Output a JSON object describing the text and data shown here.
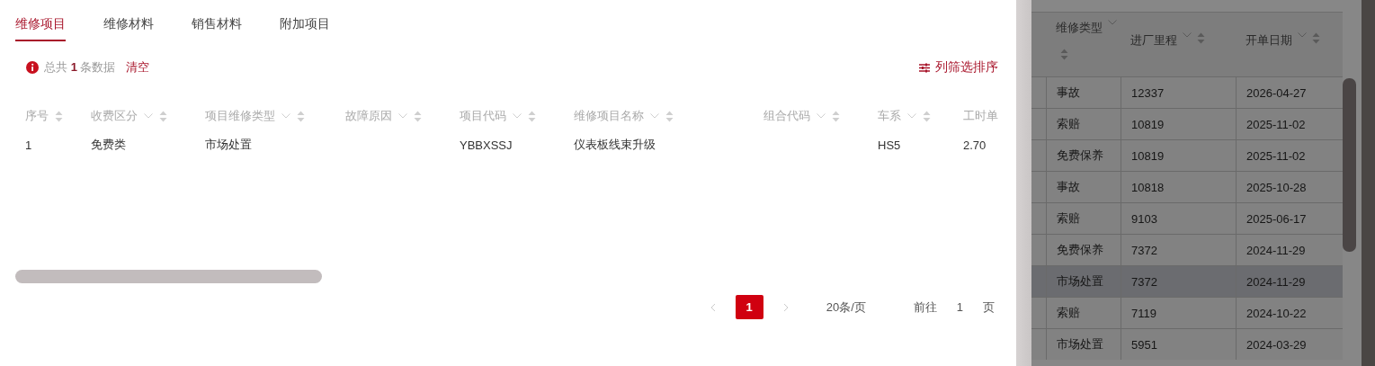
{
  "tabs": [
    {
      "label": "维修项目",
      "selected": true
    },
    {
      "label": "维修材料",
      "selected": false
    },
    {
      "label": "销售材料",
      "selected": false
    },
    {
      "label": "附加项目",
      "selected": false
    }
  ],
  "summary": {
    "prefix": "总共",
    "count": "1",
    "suffix": "条数据",
    "clear": "清空"
  },
  "column_sort_button": "列筛选排序",
  "table": {
    "columns": [
      {
        "label": "序号",
        "filter": false,
        "sortable": true
      },
      {
        "label": "收费区分",
        "filter": true,
        "sortable": true
      },
      {
        "label": "项目维修类型",
        "filter": true,
        "sortable": true
      },
      {
        "label": "故障原因",
        "filter": true,
        "sortable": true
      },
      {
        "label": "项目代码",
        "filter": true,
        "sortable": true
      },
      {
        "label": "维修项目名称",
        "filter": true,
        "sortable": true
      },
      {
        "label": "组合代码",
        "filter": true,
        "sortable": true
      },
      {
        "label": "车系",
        "filter": true,
        "sortable": true
      },
      {
        "label": "工时单",
        "filter": false,
        "sortable": false
      }
    ],
    "rows": [
      [
        "1",
        "免费类",
        "市场处置",
        "",
        "YBBXSSJ",
        "仪表板线束升级",
        "",
        "HS5",
        "2.70"
      ]
    ]
  },
  "pagination": {
    "pages": [
      {
        "label": "1",
        "selected": true
      }
    ],
    "page_size": "20条/页",
    "goto_prefix": "前往",
    "goto_value": "1",
    "goto_suffix": "页"
  },
  "side_table": {
    "columns": [
      {
        "label": "维修类型",
        "filter": true,
        "sortable": true
      },
      {
        "label": "进厂里程",
        "filter": true,
        "sortable": true
      },
      {
        "label": "开单日期",
        "filter": true,
        "sortable": true
      }
    ],
    "rows": [
      {
        "cells": [
          "事故",
          "12337",
          "2026-04-27"
        ],
        "selected": false
      },
      {
        "cells": [
          "索赔",
          "10819",
          "2025-11-02"
        ],
        "selected": false
      },
      {
        "cells": [
          "免费保养",
          "10819",
          "2025-11-02"
        ],
        "selected": false
      },
      {
        "cells": [
          "事故",
          "10818",
          "2025-10-28"
        ],
        "selected": false
      },
      {
        "cells": [
          "索赔",
          "9103",
          "2025-06-17"
        ],
        "selected": false
      },
      {
        "cells": [
          "免费保养",
          "7372",
          "2024-11-29"
        ],
        "selected": false
      },
      {
        "cells": [
          "市场处置",
          "7372",
          "2024-11-29"
        ],
        "selected": true
      },
      {
        "cells": [
          "索赔",
          "7119",
          "2024-10-22"
        ],
        "selected": false
      },
      {
        "cells": [
          "市场处置",
          "5951",
          "2024-03-29"
        ],
        "selected": false
      }
    ]
  }
}
